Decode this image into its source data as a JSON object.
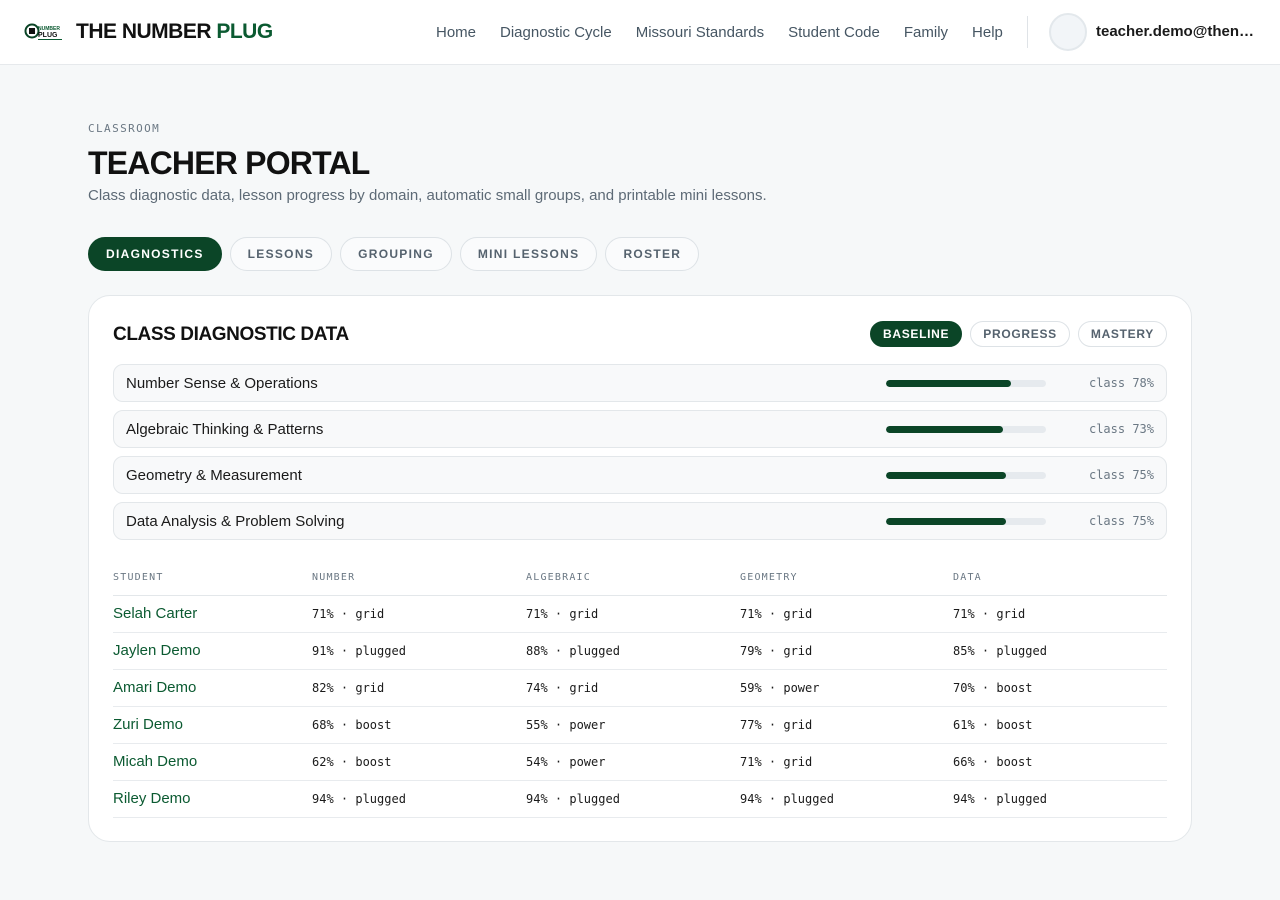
{
  "header": {
    "brand_part1": "THE NUMBER",
    "brand_part2": "PLUG",
    "logo_text_top": "NUMBER",
    "logo_text_bottom": "PLUG",
    "nav": [
      "Home",
      "Diagnostic Cycle",
      "Missouri Standards",
      "Student Code",
      "Family",
      "Help"
    ],
    "user_email": "teacher.demo@thenu..."
  },
  "page": {
    "eyebrow": "CLASSROOM",
    "title": "TEACHER PORTAL",
    "subtitle": "Class diagnostic data, lesson progress by domain, automatic small groups, and printable mini lessons."
  },
  "tabs": [
    {
      "label": "DIAGNOSTICS",
      "active": true
    },
    {
      "label": "LESSONS",
      "active": false
    },
    {
      "label": "GROUPING",
      "active": false
    },
    {
      "label": "MINI LESSONS",
      "active": false
    },
    {
      "label": "ROSTER",
      "active": false
    }
  ],
  "card": {
    "title": "CLASS DIAGNOSTIC DATA",
    "segments": [
      {
        "label": "BASELINE",
        "active": true
      },
      {
        "label": "PROGRESS",
        "active": false
      },
      {
        "label": "MASTERY",
        "active": false
      }
    ],
    "domains": [
      {
        "name": "Number Sense & Operations",
        "percent": 78,
        "label": "class 78%"
      },
      {
        "name": "Algebraic Thinking & Patterns",
        "percent": 73,
        "label": "class 73%"
      },
      {
        "name": "Geometry & Measurement",
        "percent": 75,
        "label": "class 75%"
      },
      {
        "name": "Data Analysis & Problem Solving",
        "percent": 75,
        "label": "class 75%"
      }
    ],
    "table": {
      "headers": [
        "STUDENT",
        "NUMBER",
        "ALGEBRAIC",
        "GEOMETRY",
        "DATA"
      ],
      "rows": [
        [
          "Selah Carter",
          "71% · grid",
          "71% · grid",
          "71% · grid",
          "71% · grid"
        ],
        [
          "Jaylen Demo",
          "91% · plugged",
          "88% · plugged",
          "79% · grid",
          "85% · plugged"
        ],
        [
          "Amari Demo",
          "82% · grid",
          "74% · grid",
          "59% · power",
          "70% · boost"
        ],
        [
          "Zuri Demo",
          "68% · boost",
          "55% · power",
          "77% · grid",
          "61% · boost"
        ],
        [
          "Micah Demo",
          "62% · boost",
          "54% · power",
          "71% · grid",
          "66% · boost"
        ],
        [
          "Riley Demo",
          "94% · plugged",
          "94% · plugged",
          "94% · plugged",
          "94% · plugged"
        ]
      ]
    }
  },
  "colors": {
    "brand_green": "#0b4527",
    "link_green": "#0b5a31",
    "page_bg": "#f6f8f9"
  }
}
